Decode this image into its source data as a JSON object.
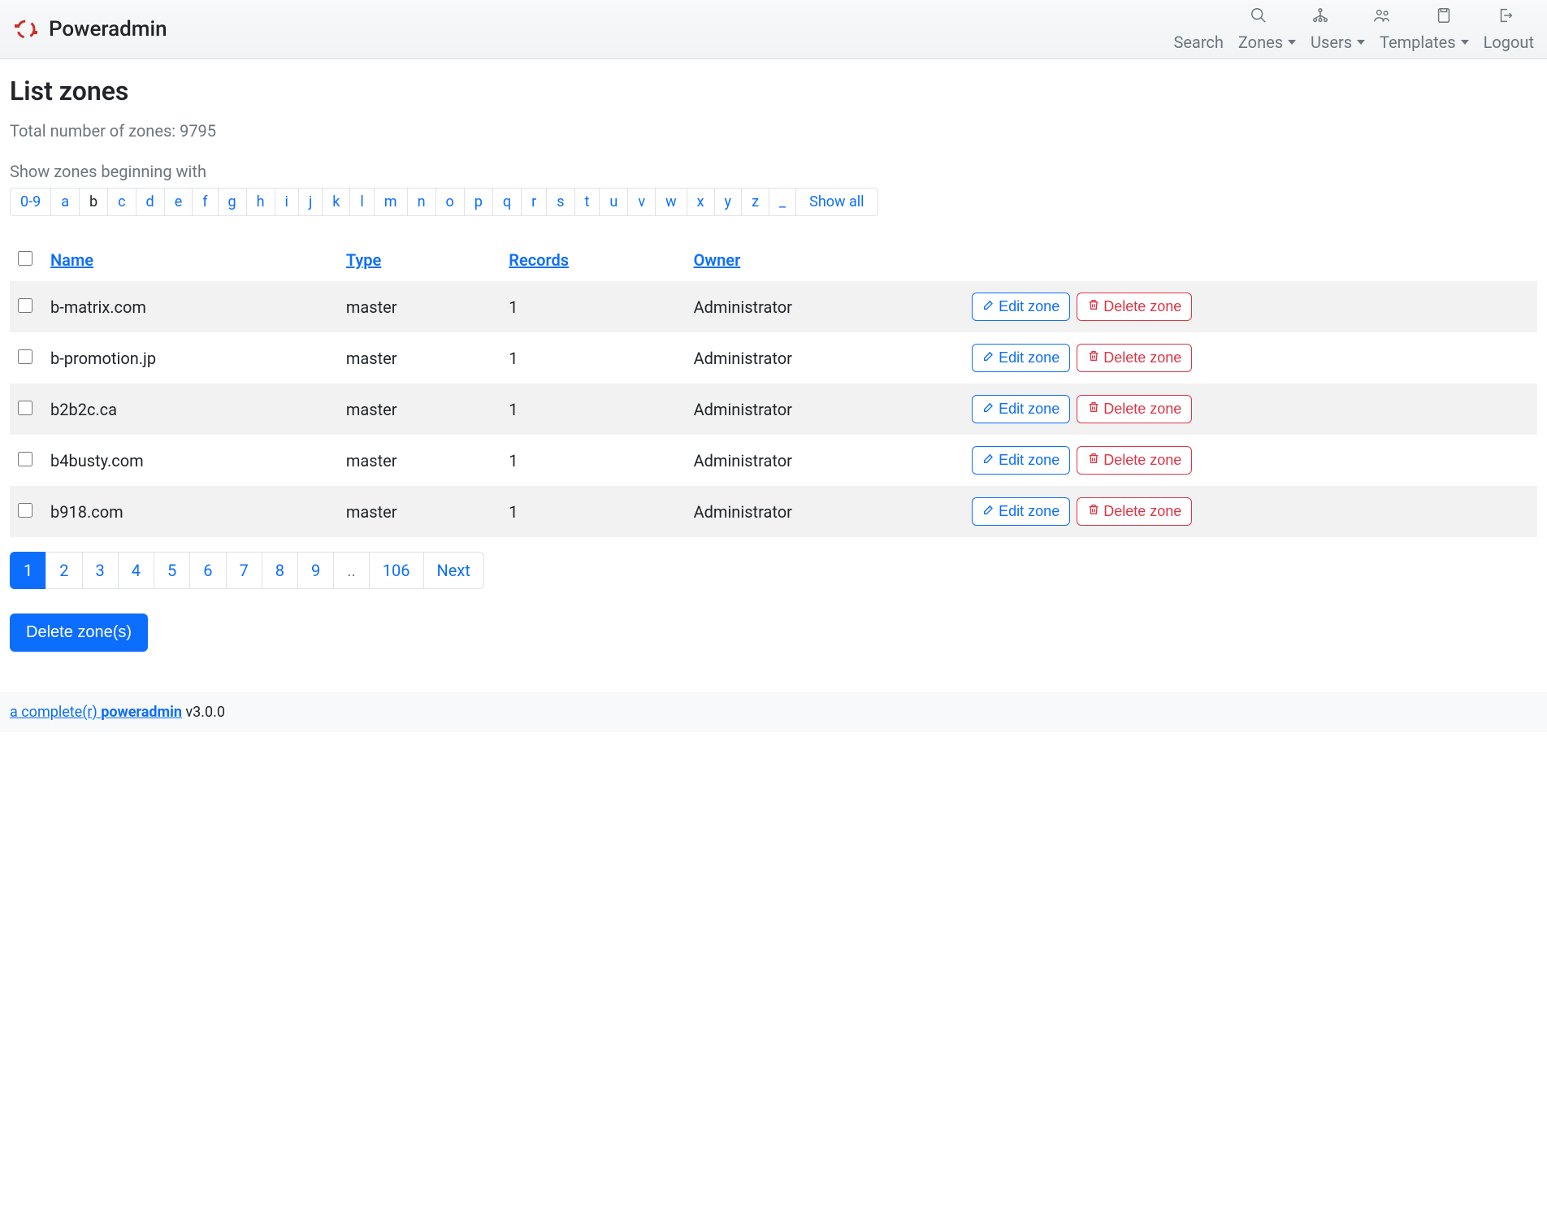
{
  "brand": "Poweradmin",
  "nav": {
    "search": "Search",
    "zones": "Zones",
    "users": "Users",
    "templates": "Templates",
    "logout": "Logout"
  },
  "page": {
    "title": "List zones",
    "total_label": "Total number of zones: 9795",
    "filter_label": "Show zones beginning with"
  },
  "letters": {
    "digits": "0-9",
    "list": [
      "a",
      "b",
      "c",
      "d",
      "e",
      "f",
      "g",
      "h",
      "i",
      "j",
      "k",
      "l",
      "m",
      "n",
      "o",
      "p",
      "q",
      "r",
      "s",
      "t",
      "u",
      "v",
      "w",
      "x",
      "y",
      "z",
      "_"
    ],
    "active": "b",
    "showall": "Show all"
  },
  "table": {
    "headers": {
      "name": "Name",
      "type": "Type",
      "records": "Records",
      "owner": "Owner"
    },
    "rows": [
      {
        "name": "b-matrix.com",
        "type": "master",
        "records": "1",
        "owner": "Administrator"
      },
      {
        "name": "b-promotion.jp",
        "type": "master",
        "records": "1",
        "owner": "Administrator"
      },
      {
        "name": "b2b2c.ca",
        "type": "master",
        "records": "1",
        "owner": "Administrator"
      },
      {
        "name": "b4busty.com",
        "type": "master",
        "records": "1",
        "owner": "Administrator"
      },
      {
        "name": "b918.com",
        "type": "master",
        "records": "1",
        "owner": "Administrator"
      }
    ],
    "edit_label": "Edit zone",
    "delete_label": "Delete zone"
  },
  "pagination": {
    "pages": [
      "1",
      "2",
      "3",
      "4",
      "5",
      "6",
      "7",
      "8",
      "9"
    ],
    "ellipsis": "..",
    "last": "106",
    "next": "Next",
    "active": "1"
  },
  "bulk_delete": "Delete zone(s)",
  "footer": {
    "link_text": "a complete(r) ",
    "link_bold": "poweradmin",
    "version": " v3.0.0"
  }
}
